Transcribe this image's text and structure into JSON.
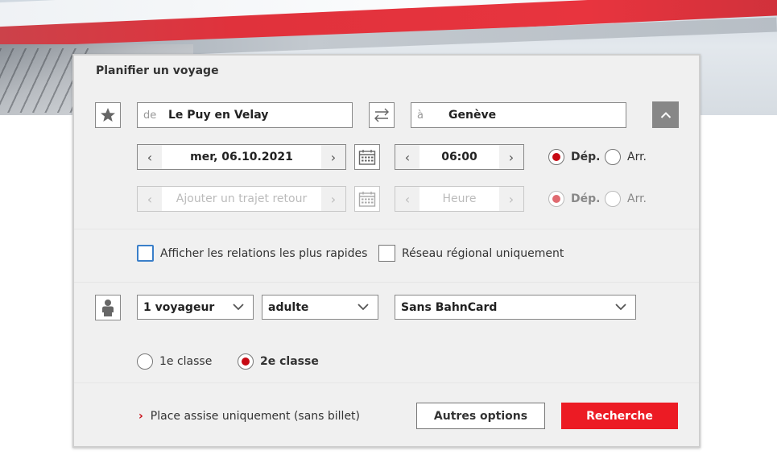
{
  "panel_title": "Planifier un voyage",
  "route": {
    "from_prefix": "de",
    "from_value": "Le Puy en Velay",
    "to_prefix": "à",
    "to_value": "Genève"
  },
  "outbound": {
    "date": "mer, 06.10.2021",
    "time": "06:00",
    "dep_label": "Dép.",
    "arr_label": "Arr.",
    "selected": "dep"
  },
  "return": {
    "date_placeholder": "Ajouter un trajet retour",
    "time_placeholder": "Heure",
    "dep_label": "Dép.",
    "arr_label": "Arr.",
    "selected": "dep"
  },
  "options": {
    "fastest_label": "Afficher les relations les plus rapides",
    "regional_label": "Réseau régional uniquement"
  },
  "passengers": {
    "count": "1 voyageur",
    "type": "adulte",
    "bahncard": "Sans BahnCard"
  },
  "class": {
    "first_label": "1e classe",
    "second_label": "2e classe",
    "selected": "2"
  },
  "footer": {
    "seat_link": "Place assise uniquement (sans billet)",
    "more_options": "Autres options",
    "search": "Recherche"
  },
  "colors": {
    "accent": "#ec1b24",
    "radio_selected": "#c70a14",
    "checkbox_focus": "#3a7fc9"
  },
  "icons": {
    "favorite": "star-icon",
    "swap": "swap-arrows-icon",
    "collapse": "chevron-up-icon",
    "calendar": "calendar-icon",
    "passenger": "person-icon"
  }
}
